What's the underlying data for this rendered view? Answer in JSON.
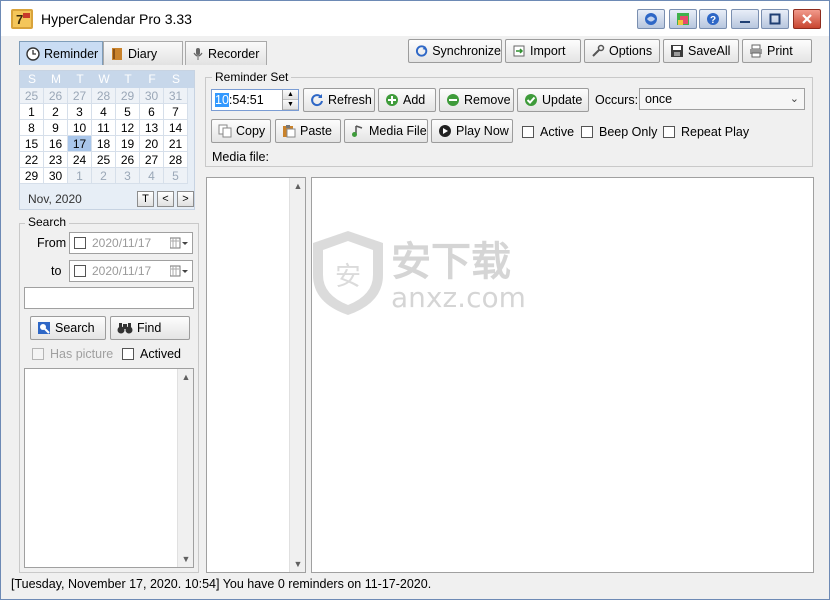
{
  "titlebar": {
    "title": "HyperCalendar Pro 3.33",
    "buttons": [
      "help-globe",
      "palette",
      "help",
      "minimize",
      "maximize",
      "close"
    ]
  },
  "tabs": [
    {
      "label": "Reminder",
      "icon": "clock-icon",
      "active": true
    },
    {
      "label": "Diary",
      "icon": "book-icon",
      "active": false
    },
    {
      "label": "Recorder",
      "icon": "microphone-icon",
      "active": false
    }
  ],
  "toolbar": {
    "synchronize": "Synchronize",
    "import": "Import",
    "options": "Options",
    "saveall": "SaveAll",
    "print": "Print"
  },
  "calendar": {
    "weekdays": [
      "S",
      "M",
      "T",
      "W",
      "T",
      "F",
      "S"
    ],
    "weeks": [
      [
        "25",
        "26",
        "27",
        "28",
        "29",
        "30",
        "31"
      ],
      [
        "1",
        "2",
        "3",
        "4",
        "5",
        "6",
        "7"
      ],
      [
        "8",
        "9",
        "10",
        "11",
        "12",
        "13",
        "14"
      ],
      [
        "15",
        "16",
        "17",
        "18",
        "19",
        "20",
        "21"
      ],
      [
        "22",
        "23",
        "24",
        "25",
        "26",
        "27",
        "28"
      ],
      [
        "29",
        "30",
        "1",
        "2",
        "3",
        "4",
        "5"
      ]
    ],
    "month_label": "Nov, 2020",
    "today_button": "T",
    "prev_button": "<",
    "next_button": ">"
  },
  "search": {
    "group_title": "Search",
    "from_label": "From",
    "to_label": "to",
    "from_date": "2020/11/17",
    "to_date": "2020/11/17",
    "query": "",
    "search_button": "Search",
    "find_button": "Find",
    "has_picture_label": "Has picture",
    "actived_label": "Actived"
  },
  "reminder_set": {
    "group_title": "Reminder Set",
    "time_selected": "10",
    "time_rest": ":54:51",
    "refresh": "Refresh",
    "add": "Add",
    "remove": "Remove",
    "update": "Update",
    "occurs_label": "Occurs:",
    "occurs_value": "once",
    "copy": "Copy",
    "paste": "Paste",
    "media_file_button": "Media File",
    "play_now": "Play Now",
    "active_label": "Active",
    "beep_only_label": "Beep Only",
    "repeat_play_label": "Repeat Play",
    "media_file_label": "Media file:"
  },
  "watermark": {
    "text_cn": "安下载",
    "text_en": "anxz.com"
  },
  "status": {
    "text": "[Tuesday, November 17, 2020. 10:54] You have 0 reminders on 11-17-2020."
  },
  "colors": {
    "selection_blue": "#3399ff",
    "calendar_today": "#a9c6ea",
    "close_button": "#c84630"
  }
}
